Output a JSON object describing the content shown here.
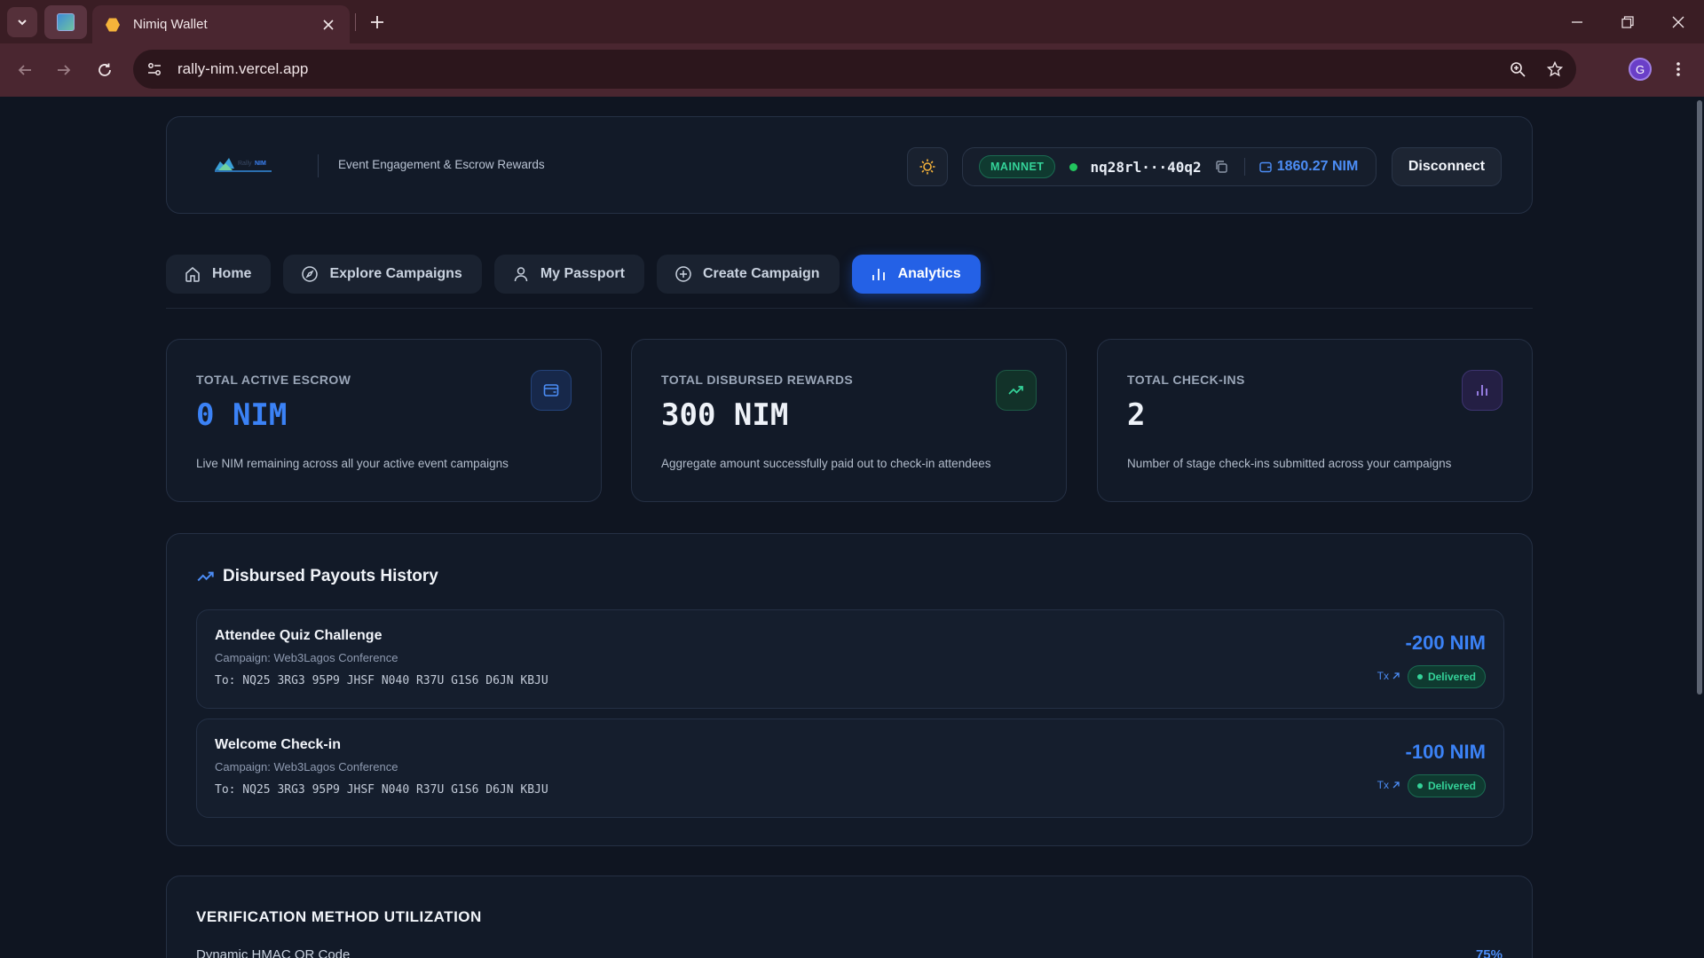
{
  "browser": {
    "tab_title": "Nimiq Wallet",
    "url": "rally-nim.vercel.app",
    "profile_initial": "G"
  },
  "header": {
    "logo_text": "RallyNIM",
    "tagline": "Event Engagement & Escrow Rewards",
    "network": "MAINNET",
    "address": "nq28rl···40q2",
    "balance": "1860.27 NIM",
    "disconnect_label": "Disconnect"
  },
  "nav": {
    "items": [
      {
        "label": "Home",
        "icon": "home-icon"
      },
      {
        "label": "Explore Campaigns",
        "icon": "compass-icon"
      },
      {
        "label": "My Passport",
        "icon": "user-icon"
      },
      {
        "label": "Create Campaign",
        "icon": "plus-circle-icon"
      },
      {
        "label": "Analytics",
        "icon": "bar-chart-icon",
        "active": true
      }
    ]
  },
  "stats": [
    {
      "label": "TOTAL ACTIVE ESCROW",
      "value": "0 NIM",
      "desc": "Live NIM remaining across all your active event campaigns",
      "icon": "wallet-icon",
      "accent": "#3b82f6"
    },
    {
      "label": "TOTAL DISBURSED REWARDS",
      "value": "300 NIM",
      "desc": "Aggregate amount successfully paid out to check-in attendees",
      "icon": "trending-up-icon",
      "accent": "#34d399"
    },
    {
      "label": "TOTAL CHECK-INS",
      "value": "2",
      "desc": "Number of stage check-ins submitted across your campaigns",
      "icon": "bar-chart-icon",
      "accent": "#a78bfa"
    }
  ],
  "payouts": {
    "title": "Disbursed Payouts History",
    "rows": [
      {
        "title": "Attendee Quiz Challenge",
        "campaign": "Campaign: Web3Lagos Conference",
        "to": "To: NQ25 3RG3 95P9 JHSF N040 R37U G1S6 D6JN KBJU",
        "amount": "-200 NIM",
        "tx": "Tx",
        "status": "Delivered"
      },
      {
        "title": "Welcome Check-in",
        "campaign": "Campaign: Web3Lagos Conference",
        "to": "To: NQ25 3RG3 95P9 JHSF N040 R37U G1S6 D6JN KBJU",
        "amount": "-100 NIM",
        "tx": "Tx",
        "status": "Delivered"
      }
    ]
  },
  "verification": {
    "title": "VERIFICATION METHOD UTILIZATION",
    "first_label": "Dynamic HMAC QR Code",
    "first_pct": "75%"
  },
  "colors": {
    "accent": "#2461e6",
    "amount": "#3b82f6",
    "success": "#34d399",
    "background": "#0f1521"
  }
}
